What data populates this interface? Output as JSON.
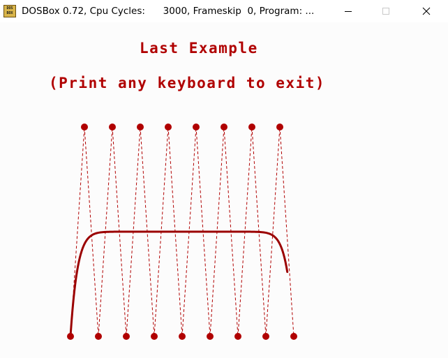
{
  "window": {
    "title": "DOSBox 0.72, Cpu Cycles:      3000, Frameskip  0, Program: ...",
    "icon_text": "DOS BOX",
    "min_icon": "minimize-icon",
    "max_icon": "maximize-icon",
    "close_icon": "close-icon"
  },
  "screen": {
    "heading": "Last Example",
    "subtitle": "(Print any keyboard to exit)"
  },
  "colors": {
    "accent": "#b00000",
    "curve": "#9b0000",
    "background": "#fcfcfc"
  }
}
